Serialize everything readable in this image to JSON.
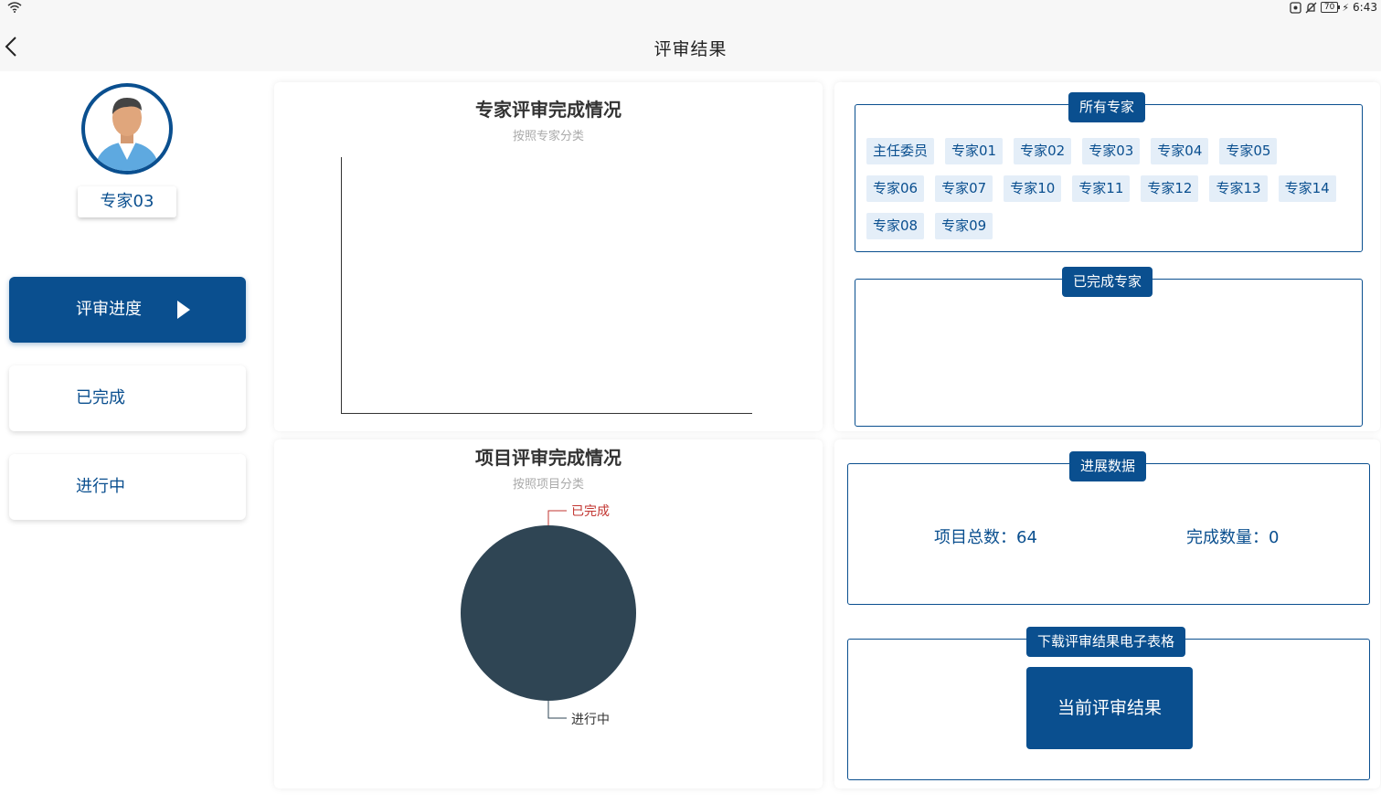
{
  "status_bar": {
    "time": "6:43",
    "battery": "70"
  },
  "header": {
    "title": "评审结果"
  },
  "profile": {
    "expert_name": "专家03"
  },
  "nav": {
    "items": [
      {
        "label": "评审进度",
        "active": true
      },
      {
        "label": "已完成",
        "active": false
      },
      {
        "label": "进行中",
        "active": false
      }
    ]
  },
  "expert_chart": {
    "title": "专家评审完成情况",
    "subtitle": "按照专家分类"
  },
  "project_chart": {
    "title": "项目评审完成情况",
    "subtitle": "按照项目分类"
  },
  "chart_data": [
    {
      "type": "bar",
      "title": "专家评审完成情况",
      "subtitle": "按照专家分类",
      "categories": [],
      "values": []
    },
    {
      "type": "pie",
      "title": "项目评审完成情况",
      "subtitle": "按照项目分类",
      "slices": [
        {
          "label": "已完成",
          "value": 0,
          "color": "#c23531"
        },
        {
          "label": "进行中",
          "value": 64,
          "color": "#2f4554"
        }
      ]
    }
  ],
  "all_experts": {
    "legend": "所有专家",
    "experts": [
      "主任委员",
      "专家01",
      "专家02",
      "专家03",
      "专家04",
      "专家05",
      "专家06",
      "专家07",
      "专家10",
      "专家11",
      "专家12",
      "专家13",
      "专家14",
      "专家08",
      "专家09"
    ]
  },
  "completed_experts": {
    "legend": "已完成专家"
  },
  "progress": {
    "legend": "进展数据",
    "total_label": "项目总数：64",
    "done_label": "完成数量：0"
  },
  "download": {
    "legend": "下载评审结果电子表格",
    "button_label": "当前评审结果"
  },
  "colors": {
    "primary": "#0a4f8f",
    "chip_bg": "#e4eef8",
    "pie_in_progress": "#2f4554",
    "pie_done": "#c23531"
  }
}
